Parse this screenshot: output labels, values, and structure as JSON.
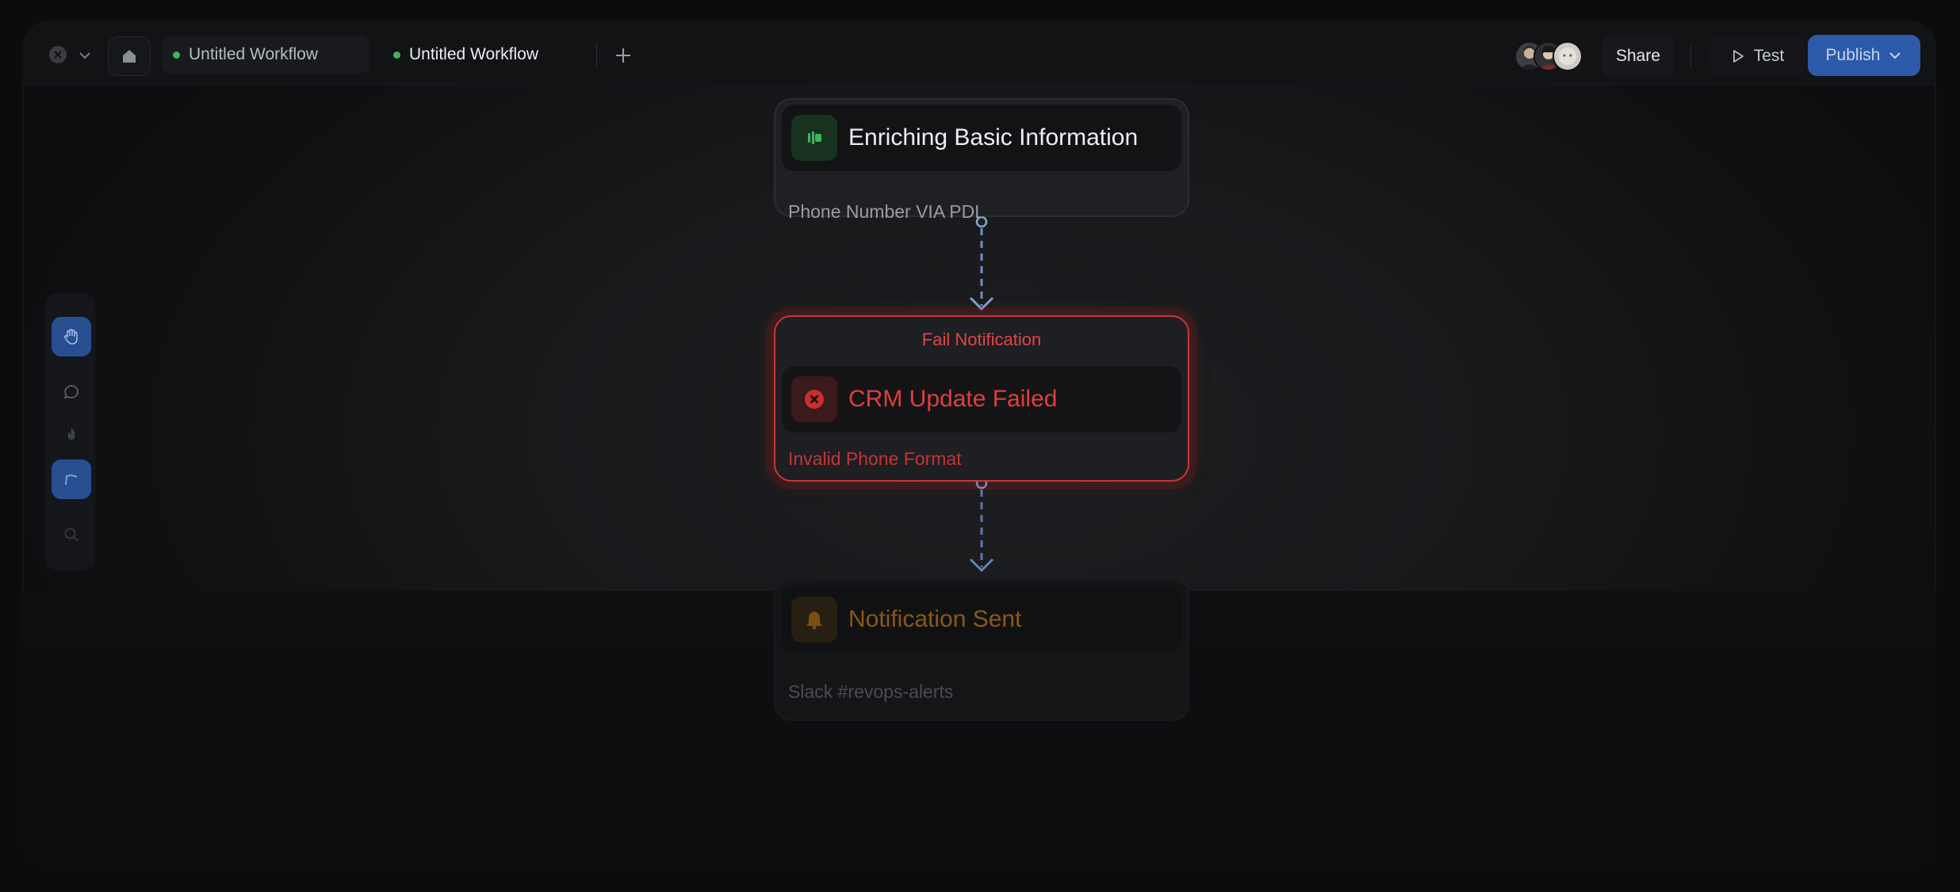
{
  "titlebar": {
    "tabs": [
      {
        "label": "Untitled Workflow"
      },
      {
        "label": "Untitled Workflow"
      }
    ],
    "share_label": "Share",
    "test_label": "Test",
    "publish_label": "Publish"
  },
  "toolbar": {
    "tools": [
      "hand-icon",
      "comment-icon",
      "flame-icon",
      "pen-icon",
      "search-icon"
    ],
    "active": [
      "hand-icon",
      "pen-icon"
    ]
  },
  "nodes": [
    {
      "title": "Enriching Basic Information",
      "subtitle": "Phone Number VIA PDL",
      "icon": "slider-icon",
      "status": "default"
    },
    {
      "header": "Fail Notification",
      "title": "CRM Update Failed",
      "subtitle": "Invalid Phone Format",
      "icon": "error-icon",
      "status": "error"
    },
    {
      "title": "Notification Sent",
      "subtitle": "Slack #revops-alerts",
      "icon": "bell-icon",
      "status": "dimmed"
    }
  ],
  "colors": {
    "accent": "#2d5aa8",
    "error": "#e03e3e",
    "success": "#3fb460",
    "warning": "#8a5a12"
  }
}
